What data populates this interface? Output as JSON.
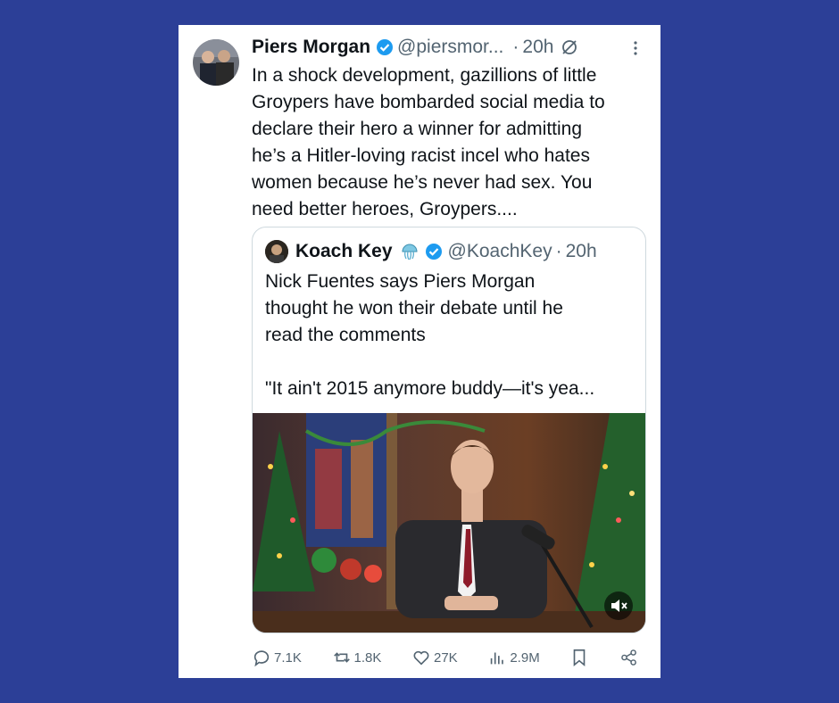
{
  "tweet": {
    "author_name": "Piers Morgan",
    "author_handle": "@piersmor...",
    "separator": "·",
    "time": "20h",
    "text": "In a shock development, gazillions of little\nGroypers have bombarded social media to\ndeclare their hero a winner for admitting\nhe’s a Hitler-loving racist incel who hates\nwomen because he’s never had sex. You\nneed better heroes, Groypers...."
  },
  "quote": {
    "author_name": "Koach Key",
    "author_handle": "@KoachKey",
    "separator": "·",
    "time": "20h",
    "text": "Nick Fuentes says Piers Morgan\nthought he won their debate until he\nread the comments\n\n\"It ain't 2015 anymore buddy—it's yea..."
  },
  "actions": {
    "replies": "7.1K",
    "reposts": "1.8K",
    "likes": "27K",
    "views": "2.9M"
  },
  "colors": {
    "background": "#2c3f97",
    "verified": "#1d9bf0",
    "muted_text": "#536471"
  },
  "icons": [
    "verified-badge-icon",
    "grok-icon",
    "more-icon",
    "jellyfish-icon",
    "mute-icon",
    "reply-icon",
    "repost-icon",
    "like-icon",
    "views-icon",
    "bookmark-icon",
    "share-icon"
  ]
}
